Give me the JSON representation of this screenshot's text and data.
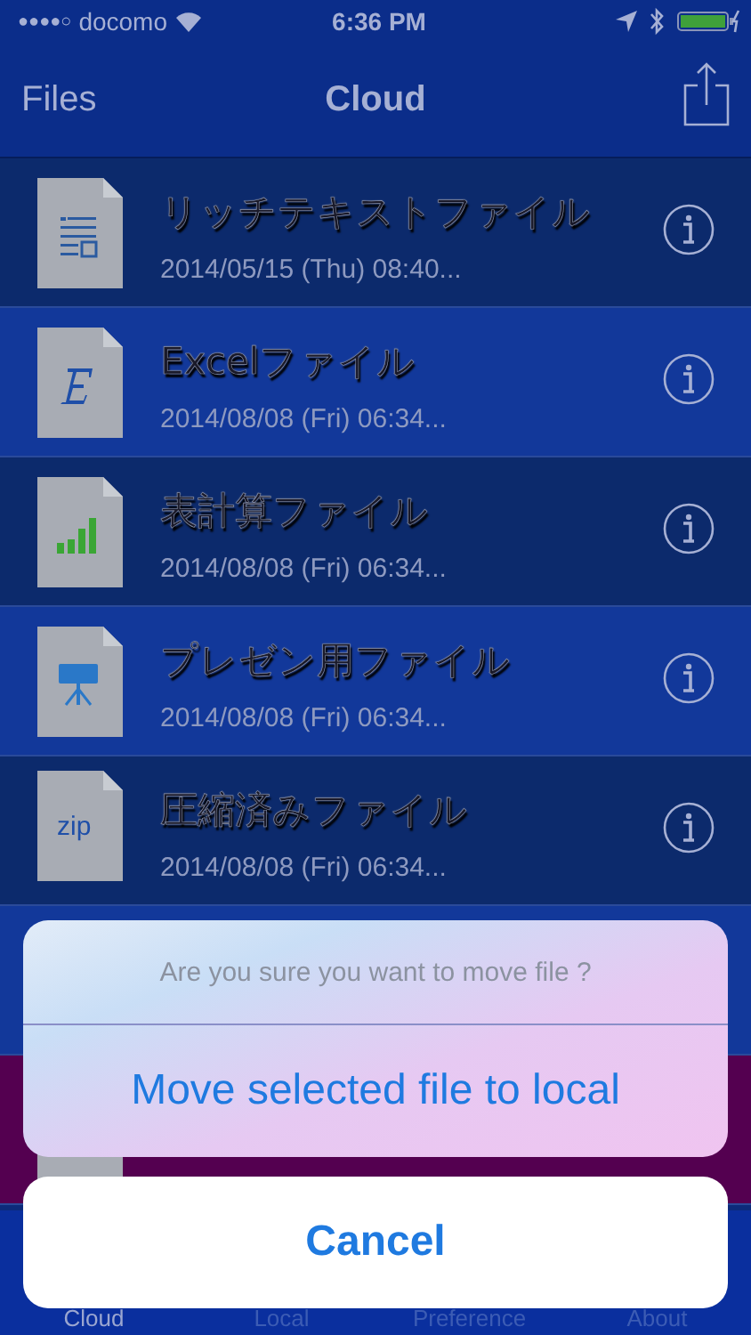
{
  "status_bar": {
    "signal": "●●●●○",
    "carrier": "docomo",
    "time": "6:36 PM"
  },
  "nav": {
    "back": "Files",
    "title": "Cloud"
  },
  "rows": [
    {
      "kind": "richtext",
      "title": "リッチテキストファイル",
      "date": "2014/05/15 (Thu) 08:40...",
      "selected": false
    },
    {
      "kind": "excel",
      "title": "Excelファイル",
      "date": "2014/08/08 (Fri) 06:34...",
      "selected": false
    },
    {
      "kind": "sheet",
      "title": "表計算ファイル",
      "date": "2014/08/08 (Fri) 06:34...",
      "selected": false
    },
    {
      "kind": "presentation",
      "title": "プレゼン用ファイル",
      "date": "2014/08/08 (Fri) 06:34...",
      "selected": false
    },
    {
      "kind": "zip",
      "badge": "zip",
      "title": "圧縮済みファイル",
      "date": "2014/08/08 (Fri) 06:34...",
      "selected": false
    },
    {
      "kind": "hidden",
      "selected": false
    },
    {
      "kind": "blank",
      "selected": true
    }
  ],
  "action_sheet": {
    "message": "Are you sure you want to move file ?",
    "action": "Move selected file to local",
    "cancel": "Cancel"
  },
  "tabs": [
    {
      "label": "Cloud",
      "selected": true
    },
    {
      "label": "Local",
      "selected": false
    },
    {
      "label": "Preference",
      "selected": false
    },
    {
      "label": "About",
      "selected": false
    }
  ]
}
